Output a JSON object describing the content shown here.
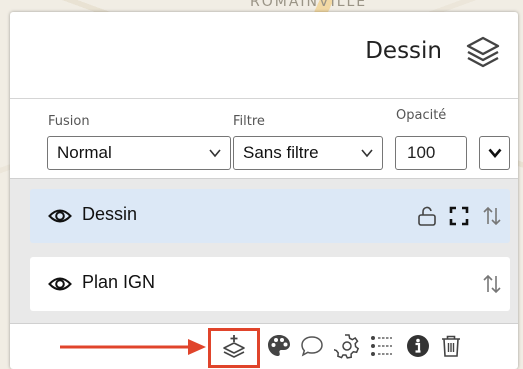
{
  "map": {
    "label": "ROMAINVILLE"
  },
  "header": {
    "title": "Dessin",
    "layers_icon": "layers-stack-icon"
  },
  "controls": {
    "fusion": {
      "label": "Fusion",
      "value": "Normal"
    },
    "filtre": {
      "label": "Filtre",
      "value": "Sans filtre"
    },
    "opacite": {
      "label": "Opacité",
      "value": "100"
    }
  },
  "layers": [
    {
      "name": "Dessin",
      "active": true,
      "icons": [
        "eye-icon",
        "unlock-icon",
        "expand-icon",
        "sort-arrows-icon"
      ]
    },
    {
      "name": "Plan IGN",
      "active": false,
      "icons": [
        "eye-icon",
        "sort-arrows-icon"
      ]
    }
  ],
  "toolbar": {
    "icons": [
      "add-layer-icon",
      "palette-icon",
      "comment-icon",
      "gear-icon",
      "list-icon",
      "info-icon",
      "trash-icon"
    ],
    "highlight_color": "#e0442b",
    "accent_color": "#dce8f6"
  }
}
